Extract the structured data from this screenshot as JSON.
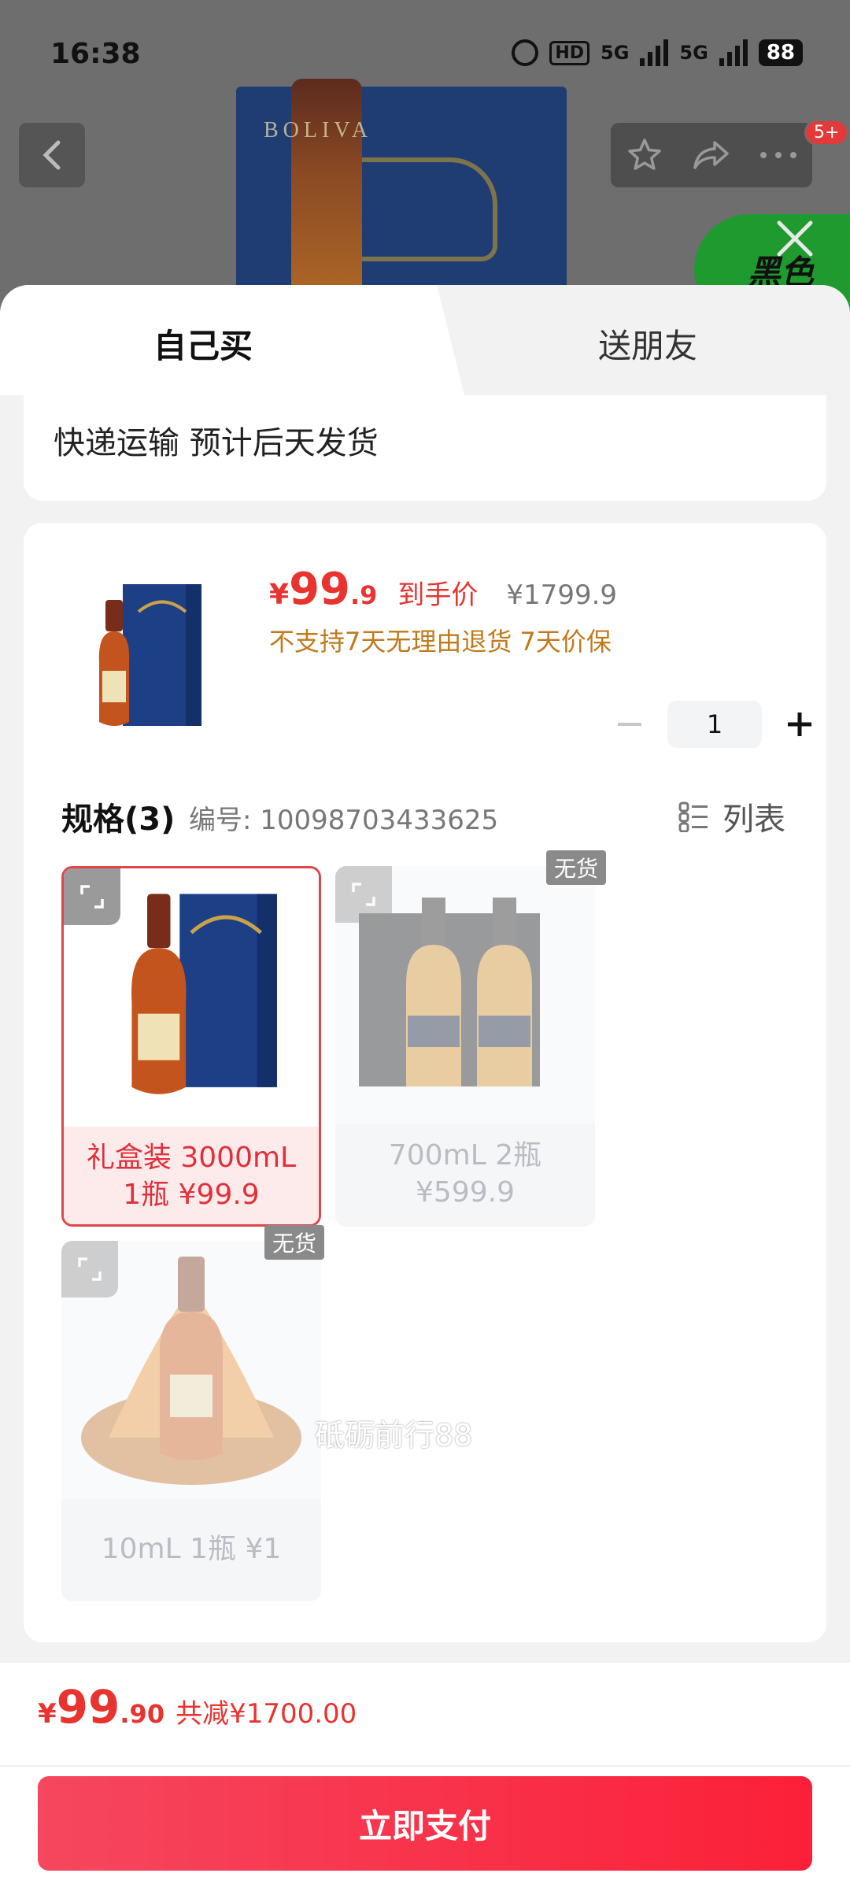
{
  "status_bar": {
    "time": "16:38",
    "hd_label": "HD",
    "net1": "5G",
    "net2": "5G",
    "battery": "88"
  },
  "background": {
    "brand_text": "BOLIVA",
    "notification_count": "5+",
    "promo_text": "黑色"
  },
  "tabs": {
    "self_buy": "自己买",
    "gift_friend": "送朋友"
  },
  "shipping": {
    "text": "快递运输 预计后天发货"
  },
  "product": {
    "currency": "¥",
    "price_int": "99",
    "price_dec": ".9",
    "price_tag": "到手价",
    "original_price": "¥1799.9",
    "notice": "不支持7天无理由退货 7天价保",
    "quantity": "1"
  },
  "spec": {
    "title": "规格(3)",
    "code": "编号: 10098703433625",
    "list_label": "列表",
    "out_of_stock": "无货",
    "options": [
      {
        "label": "礼盒装 3000mL 1瓶 ¥99.9",
        "selected": true,
        "available": true
      },
      {
        "label": "700mL 2瓶 ¥599.9",
        "selected": false,
        "available": false
      },
      {
        "label": "10mL 1瓶 ¥1",
        "selected": false,
        "available": false
      }
    ]
  },
  "watermark": "砥砺前行88",
  "footer": {
    "currency": "¥",
    "total_int": "99",
    "total_dec": ".90",
    "saving": "共减¥1700.00",
    "pay_label": "立即支付"
  },
  "colors": {
    "accent_red": "#e8332f",
    "notice_orange": "#c07a1c",
    "pay_gradient_start": "#f5475f",
    "pay_gradient_end": "#fb2038"
  }
}
